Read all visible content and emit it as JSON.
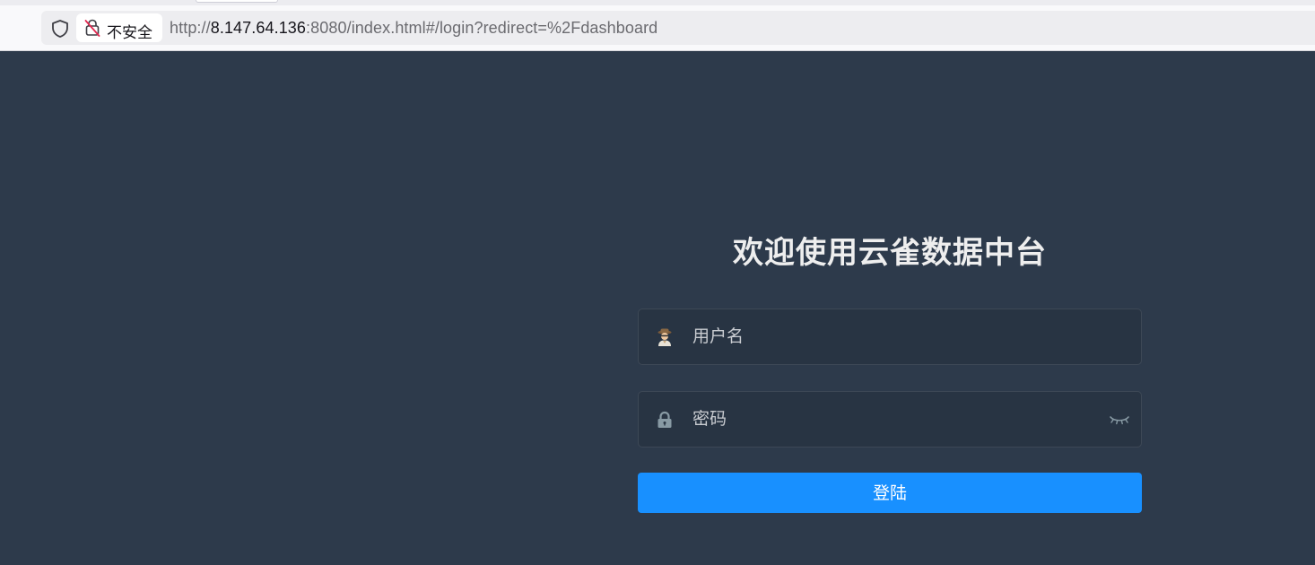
{
  "browser": {
    "security_label": "不安全",
    "url_scheme": "http://",
    "url_host": "8.147.64.136",
    "url_rest": ":8080/index.html#/login?redirect=%2Fdashboard"
  },
  "login": {
    "title": "欢迎使用云雀数据中台",
    "username_placeholder": "用户名",
    "password_placeholder": "密码",
    "submit_label": "登陆",
    "username_icon": "user-avatar-icon",
    "password_icon": "lock-icon",
    "toggle_icon": "eye-closed-icon"
  },
  "colors": {
    "background": "#2d3a4b",
    "input_background": "#283443",
    "primary_button": "#1890ff",
    "title_text": "#eeeeee"
  }
}
